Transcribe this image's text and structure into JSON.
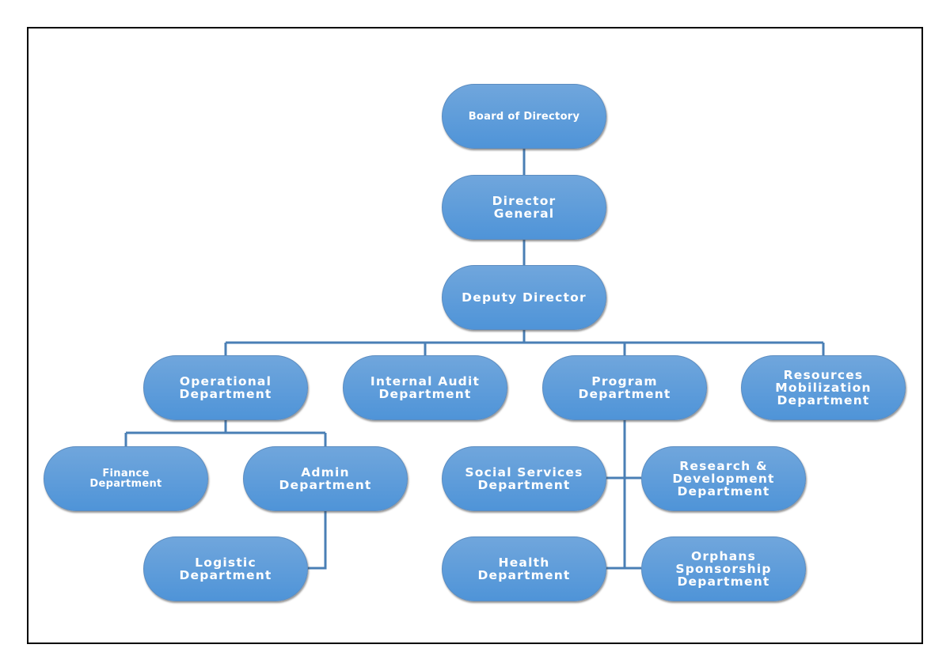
{
  "diagram": {
    "colors": {
      "node_top": "#70a6dc",
      "node_bottom": "#4f94d8",
      "connector": "#4a7fb5",
      "text": "#ffffff"
    },
    "nodes": {
      "board": "Board of Directory",
      "director_general": "Director\nGeneral",
      "deputy": "Deputy Director",
      "operational": "Operational\nDepartment",
      "internal_audit": "Internal Audit\nDepartment",
      "program": "Program\nDepartment",
      "resources": "Resources\nMobilization\nDepartment",
      "finance": "Finance\nDepartment",
      "admin": "Admin\nDepartment",
      "social": "Social Services\nDepartment",
      "research": "Research &\nDevelopment\nDepartment",
      "logistic": "Logistic\nDepartment",
      "health": "Health\nDepartment",
      "orphans": "Orphans\nSponsorship\nDepartment"
    }
  }
}
